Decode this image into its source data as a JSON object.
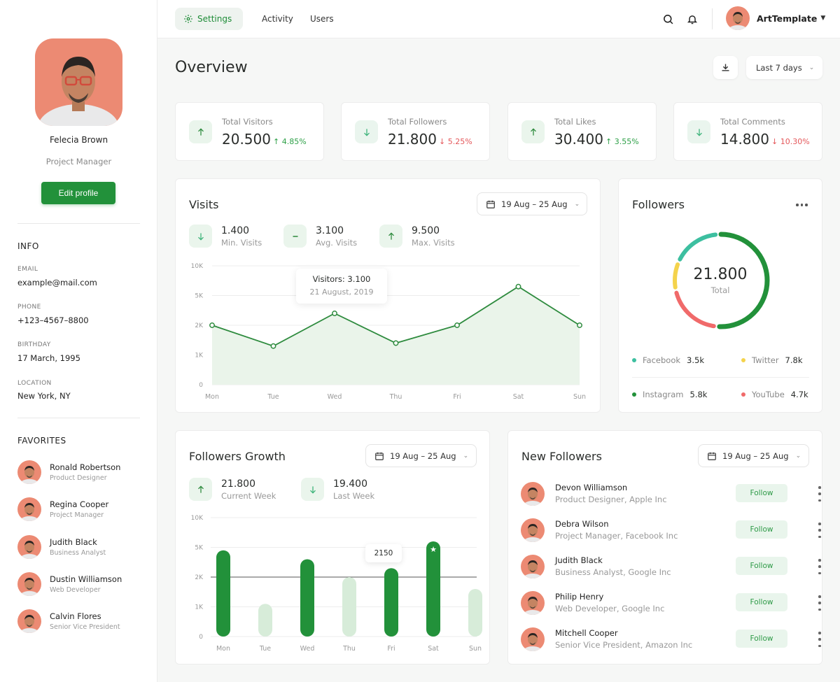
{
  "profile": {
    "name": "Felecia Brown",
    "role": "Project Manager",
    "edit_label": "Edit profile"
  },
  "info": {
    "title": "INFO",
    "fields": [
      {
        "label": "EMAIL",
        "value": "example@mail.com"
      },
      {
        "label": "PHONE",
        "value": "+123–4567–8800"
      },
      {
        "label": "BIRTHDAY",
        "value": "17 March, 1995"
      },
      {
        "label": "LOCATION",
        "value": "New York, NY"
      }
    ]
  },
  "favorites": {
    "title": "FAVORITES",
    "items": [
      {
        "name": "Ronald Robertson",
        "role": "Product Designer"
      },
      {
        "name": "Regina Cooper",
        "role": "Project Manager"
      },
      {
        "name": "Judith Black",
        "role": "Business Analyst"
      },
      {
        "name": "Dustin Williamson",
        "role": "Web Developer"
      },
      {
        "name": "Calvin Flores",
        "role": "Senior Vice President"
      }
    ]
  },
  "topbar": {
    "tabs": [
      {
        "label": "Settings",
        "icon": "gear-icon"
      },
      {
        "label": "Activity"
      },
      {
        "label": "Users"
      }
    ],
    "user_name": "ArtTemplate"
  },
  "overview": {
    "title": "Overview",
    "range_label": "Last 7 days",
    "stats": [
      {
        "label": "Total Visitors",
        "value": "20.500",
        "change": "↑ 4.85%",
        "trend": "up"
      },
      {
        "label": "Total Followers",
        "value": "21.800",
        "change": "↓ 5.25%",
        "trend": "down"
      },
      {
        "label": "Total Likes",
        "value": "30.400",
        "change": "↑ 3.55%",
        "trend": "up"
      },
      {
        "label": "Total Comments",
        "value": "14.800",
        "change": "↓ 10.30%",
        "trend": "down"
      }
    ]
  },
  "visits": {
    "title": "Visits",
    "date_range": "19 Aug – 25 Aug",
    "mini": [
      {
        "value": "1.400",
        "label": "Min. Visits",
        "icon": "arrow-down-icon"
      },
      {
        "value": "3.100",
        "label": "Avg. Visits",
        "icon": "minus-icon"
      },
      {
        "value": "9.500",
        "label": "Max. Visits",
        "icon": "arrow-up-icon"
      }
    ],
    "tooltip": {
      "title": "Visitors: 3.100",
      "date": "21 August, 2019"
    }
  },
  "followers": {
    "title": "Followers",
    "total": "21.800",
    "total_label": "Total",
    "legend": [
      {
        "name": "Facebook",
        "value": "3.5k",
        "color": "#3dbfa0"
      },
      {
        "name": "Twitter",
        "value": "7.8k",
        "color": "#f4d34c"
      },
      {
        "name": "Instagram",
        "value": "5.8k",
        "color": "#22913a"
      },
      {
        "name": "YouTube",
        "value": "4.7k",
        "color": "#f06a6a"
      }
    ]
  },
  "growth": {
    "title": "Followers Growth",
    "date_range": "19 Aug – 25 Aug",
    "mini": [
      {
        "value": "21.800",
        "label": "Current Week",
        "icon": "arrow-up-icon"
      },
      {
        "value": "19.400",
        "label": "Last Week",
        "icon": "arrow-down-icon"
      }
    ],
    "tooltip": "2150"
  },
  "new_followers": {
    "title": "New Followers",
    "date_range": "19 Aug – 25 Aug",
    "follow_label": "Follow",
    "items": [
      {
        "name": "Devon Williamson",
        "role": "Product Designer, Apple Inc"
      },
      {
        "name": "Debra Wilson",
        "role": "Project Manager, Facebook Inc"
      },
      {
        "name": "Judith Black",
        "role": "Business Analyst, Google Inc"
      },
      {
        "name": "Philip Henry",
        "role": "Web Developer, Google Inc"
      },
      {
        "name": "Mitchell Cooper",
        "role": "Senior Vice President, Amazon Inc"
      }
    ]
  },
  "chart_data": [
    {
      "type": "area",
      "title": "Visits",
      "categories": [
        "Mon",
        "Tue",
        "Wed",
        "Thu",
        "Fri",
        "Sat",
        "Sun"
      ],
      "y_tick_labels": [
        "0",
        "1K",
        "2K",
        "5K",
        "10K"
      ],
      "values": [
        2,
        1.3,
        2.4,
        1.4,
        2,
        3.3,
        2
      ],
      "series": [
        {
          "values": [
            2,
            1.3,
            2.4,
            1.4,
            2,
            3.3,
            2
          ]
        }
      ],
      "ylim": [
        0,
        4
      ],
      "grid": true,
      "color": "#2e8b3e"
    },
    {
      "type": "pie",
      "title": "Followers",
      "categories": [
        "Instagram",
        "YouTube",
        "Twitter",
        "Facebook"
      ],
      "values": [
        0.505,
        0.182,
        0.08,
        0.155
      ],
      "colors": [
        "#22913a",
        "#f06a6a",
        "#f4d34c",
        "#3dbfa0"
      ]
    },
    {
      "type": "bar",
      "title": "Followers Growth",
      "categories": [
        "Mon",
        "Tue",
        "Wed",
        "Thu",
        "Fri",
        "Sat",
        "Sun"
      ],
      "y_tick_labels": [
        "0",
        "1K",
        "2K",
        "5K",
        "10K"
      ],
      "values": [
        2.9,
        1.1,
        2.6,
        2.0,
        2.3,
        3.2,
        1.6
      ],
      "highlighted": [
        true,
        false,
        true,
        false,
        true,
        true,
        false
      ],
      "ylim": [
        0,
        4
      ],
      "grid": true,
      "colors": {
        "highlight": "#22913a",
        "muted": "#d7ecd9"
      }
    }
  ]
}
